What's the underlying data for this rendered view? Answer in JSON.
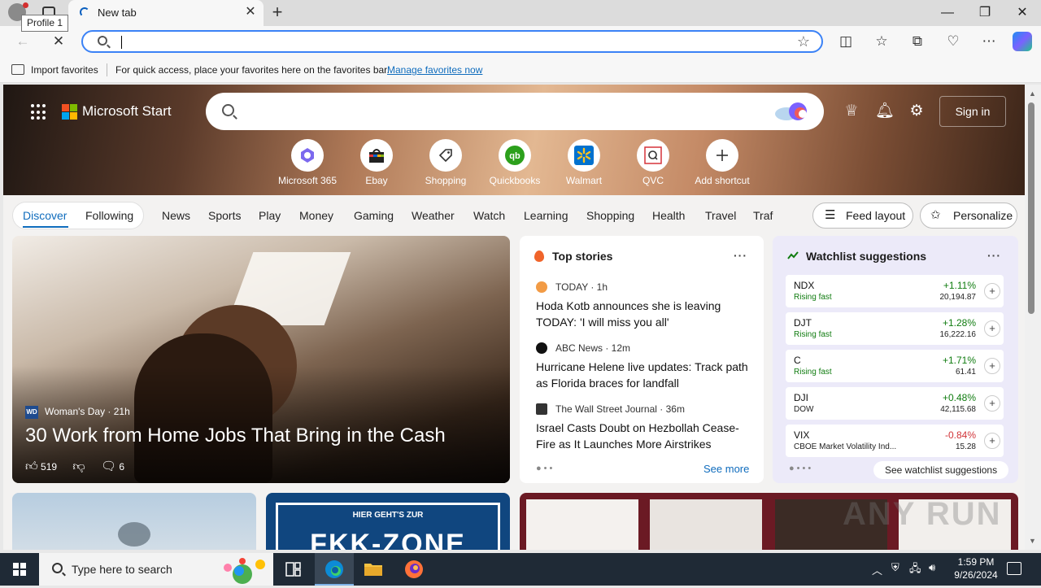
{
  "browser": {
    "profile_tooltip": "Profile 1",
    "tab_title": "New tab",
    "tab_close": "✕",
    "new_tab": "+",
    "window_controls": {
      "minimize": "—",
      "restore": "❐",
      "close": "✕"
    },
    "address_value": ""
  },
  "favorites_bar": {
    "import_label": "Import favorites",
    "message": "For quick access, place your favorites here on the favorites bar.",
    "manage_link": "Manage favorites now"
  },
  "header": {
    "brand": "Microsoft Start",
    "search_value": "",
    "sign_in": "Sign in"
  },
  "shortcuts": [
    {
      "label": "Microsoft 365",
      "icon": "m365-icon"
    },
    {
      "label": "Ebay",
      "icon": "ebay-icon"
    },
    {
      "label": "Shopping",
      "icon": "shopping-tag-icon"
    },
    {
      "label": "Quickbooks",
      "icon": "quickbooks-icon"
    },
    {
      "label": "Walmart",
      "icon": "walmart-icon"
    },
    {
      "label": "QVC",
      "icon": "qvc-icon"
    },
    {
      "label": "Add shortcut",
      "icon": "plus-icon"
    }
  ],
  "nav": {
    "discover": "Discover",
    "following": "Following",
    "items": [
      "News",
      "Sports",
      "Play",
      "Money",
      "Gaming",
      "Weather",
      "Watch",
      "Learning",
      "Shopping",
      "Health",
      "Travel",
      "Traf"
    ],
    "feed_layout": "Feed layout",
    "personalize": "Personalize"
  },
  "hero": {
    "source_logo": "WD",
    "source": "Woman's Day · 21h",
    "title": "30 Work from Home Jobs That Bring in the Cash",
    "likes": "519",
    "comments": "6"
  },
  "top_stories": {
    "title": "Top stories",
    "items": [
      {
        "source": "TODAY · 1h",
        "title": "Hoda Kotb announces she is leaving TODAY: 'I will miss you all'"
      },
      {
        "source": "ABC News · 12m",
        "title": "Hurricane Helene live updates: Track path as Florida braces for landfall"
      },
      {
        "source": "The Wall Street Journal · 36m",
        "title": "Israel Casts Doubt on Hezbollah Cease-Fire as It Launches More Airstrikes"
      }
    ],
    "see_more": "See more"
  },
  "watchlist": {
    "title": "Watchlist suggestions",
    "items": [
      {
        "symbol": "NDX",
        "sub": "Rising fast",
        "change": "+1.11%",
        "value": "20,194.87",
        "trend": "up"
      },
      {
        "symbol": "DJT",
        "sub": "Rising fast",
        "change": "+1.28%",
        "value": "16,222.16",
        "trend": "up"
      },
      {
        "symbol": "C",
        "sub": "Rising fast",
        "change": "+1.71%",
        "value": "61.41",
        "trend": "up"
      },
      {
        "symbol": "DJI",
        "sub": "DOW",
        "change": "+0.48%",
        "value": "42,115.68",
        "trend": "up"
      },
      {
        "symbol": "VIX",
        "sub": "CBOE Market Volatility Ind...",
        "change": "-0.84%",
        "value": "15.28",
        "trend": "down"
      }
    ],
    "see_all": "See watchlist suggestions"
  },
  "promo": {
    "small": "HIER GEHT'S ZUR",
    "big": "FKK-ZONE"
  },
  "watermark": "ANY RUN",
  "taskbar": {
    "search_placeholder": "Type here to search",
    "time": "1:59 PM",
    "date": "9/26/2024"
  },
  "colors": {
    "accent": "#0f6cbd",
    "positive": "#107c10",
    "negative": "#d13438"
  }
}
